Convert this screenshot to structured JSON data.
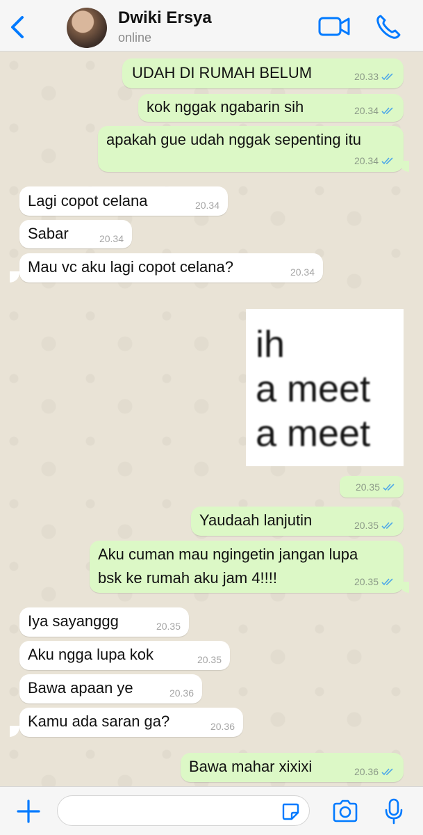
{
  "header": {
    "contact_name": "Dwiki Ersya",
    "status": "online",
    "icons": [
      "back-icon",
      "video-call-icon",
      "phone-icon"
    ]
  },
  "messages": [
    {
      "dir": "out",
      "text": "UDAH DI RUMAH BELUM",
      "time": "20.33",
      "read": true
    },
    {
      "dir": "out",
      "text": "kok nggak ngabarin sih",
      "time": "20.34",
      "read": true
    },
    {
      "dir": "out",
      "text": "apakah gue udah nggak sepenting itu",
      "time": "20.34",
      "read": true
    },
    {
      "dir": "in",
      "text": "Lagi copot celana",
      "time": "20.34"
    },
    {
      "dir": "in",
      "text": "Sabar",
      "time": "20.34"
    },
    {
      "dir": "in",
      "text": "Mau vc aku lagi copot celana?",
      "time": "20.34"
    },
    {
      "dir": "out",
      "type": "image",
      "image_text": [
        "ih",
        "a meet",
        "a meet"
      ],
      "time": "20.35",
      "read": true
    },
    {
      "dir": "out",
      "text": "Yaudaah lanjutin",
      "time": "20.35",
      "read": true
    },
    {
      "dir": "out",
      "text": "Aku cuman mau ngingetin jangan lupa",
      "text2": "bsk ke rumah aku jam 4!!!!",
      "time": "20.35",
      "read": true
    },
    {
      "dir": "in",
      "text": "Iya sayanggg",
      "time": "20.35"
    },
    {
      "dir": "in",
      "text": "Aku ngga lupa kok",
      "time": "20.35"
    },
    {
      "dir": "in",
      "text": "Bawa apaan ye",
      "time": "20.36"
    },
    {
      "dir": "in",
      "text": "Kamu ada saran ga?",
      "time": "20.36"
    },
    {
      "dir": "out",
      "text": "Bawa mahar xixixi",
      "time": "20.36",
      "read": true
    }
  ],
  "input_bar": {
    "message_value": "",
    "icons": [
      "plus-icon",
      "sticker-icon",
      "camera-icon",
      "microphone-icon"
    ]
  },
  "colors": {
    "accent": "#007aff",
    "outgoing_bubble": "#dcf8c6",
    "incoming_bubble": "#ffffff",
    "read_ticks": "#4fa8e8"
  }
}
